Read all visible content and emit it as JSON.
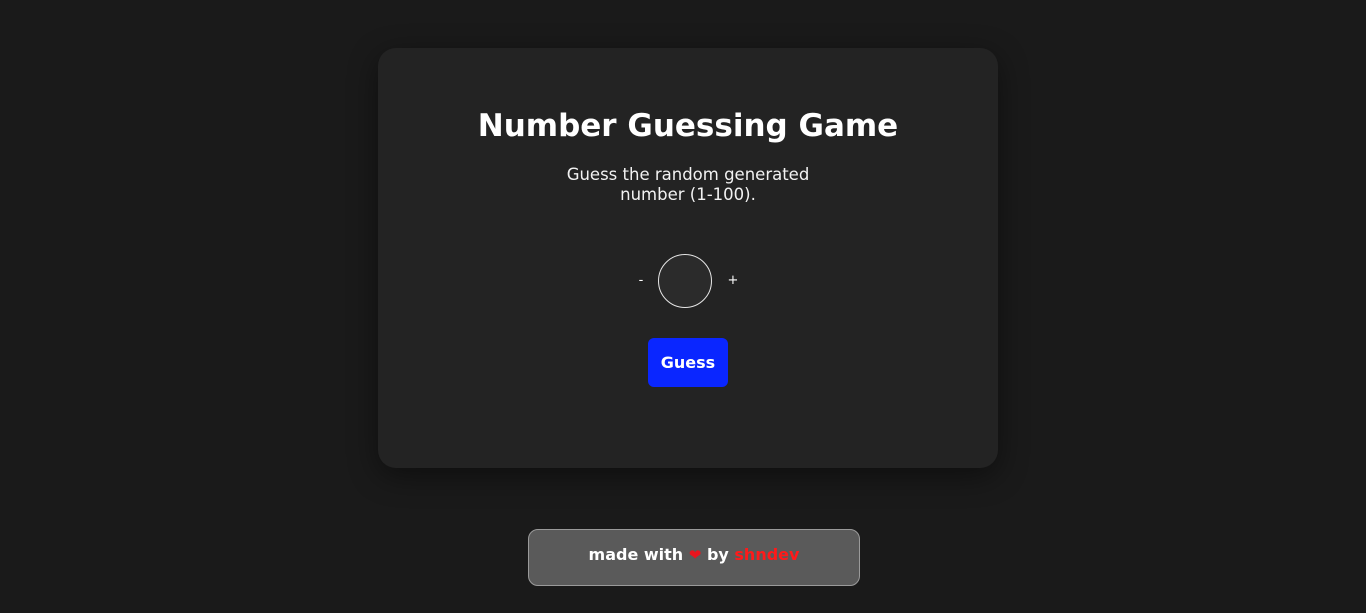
{
  "game": {
    "title": "Number Guessing Game",
    "subtitle": "Guess the random generated number (1-100).",
    "minus_label": "-",
    "plus_label": "+",
    "input_value": "",
    "guess_label": "Guess"
  },
  "footer": {
    "made_with": "made with",
    "heart": "❤",
    "by": "by",
    "author": "shndev"
  },
  "colors": {
    "background": "#1a1a1a",
    "card": "#232323",
    "accent_button": "#0a26ff",
    "heart": "#e8141e",
    "author_link": "#ff1a1a"
  },
  "icons": {
    "heart": "heart-icon"
  }
}
